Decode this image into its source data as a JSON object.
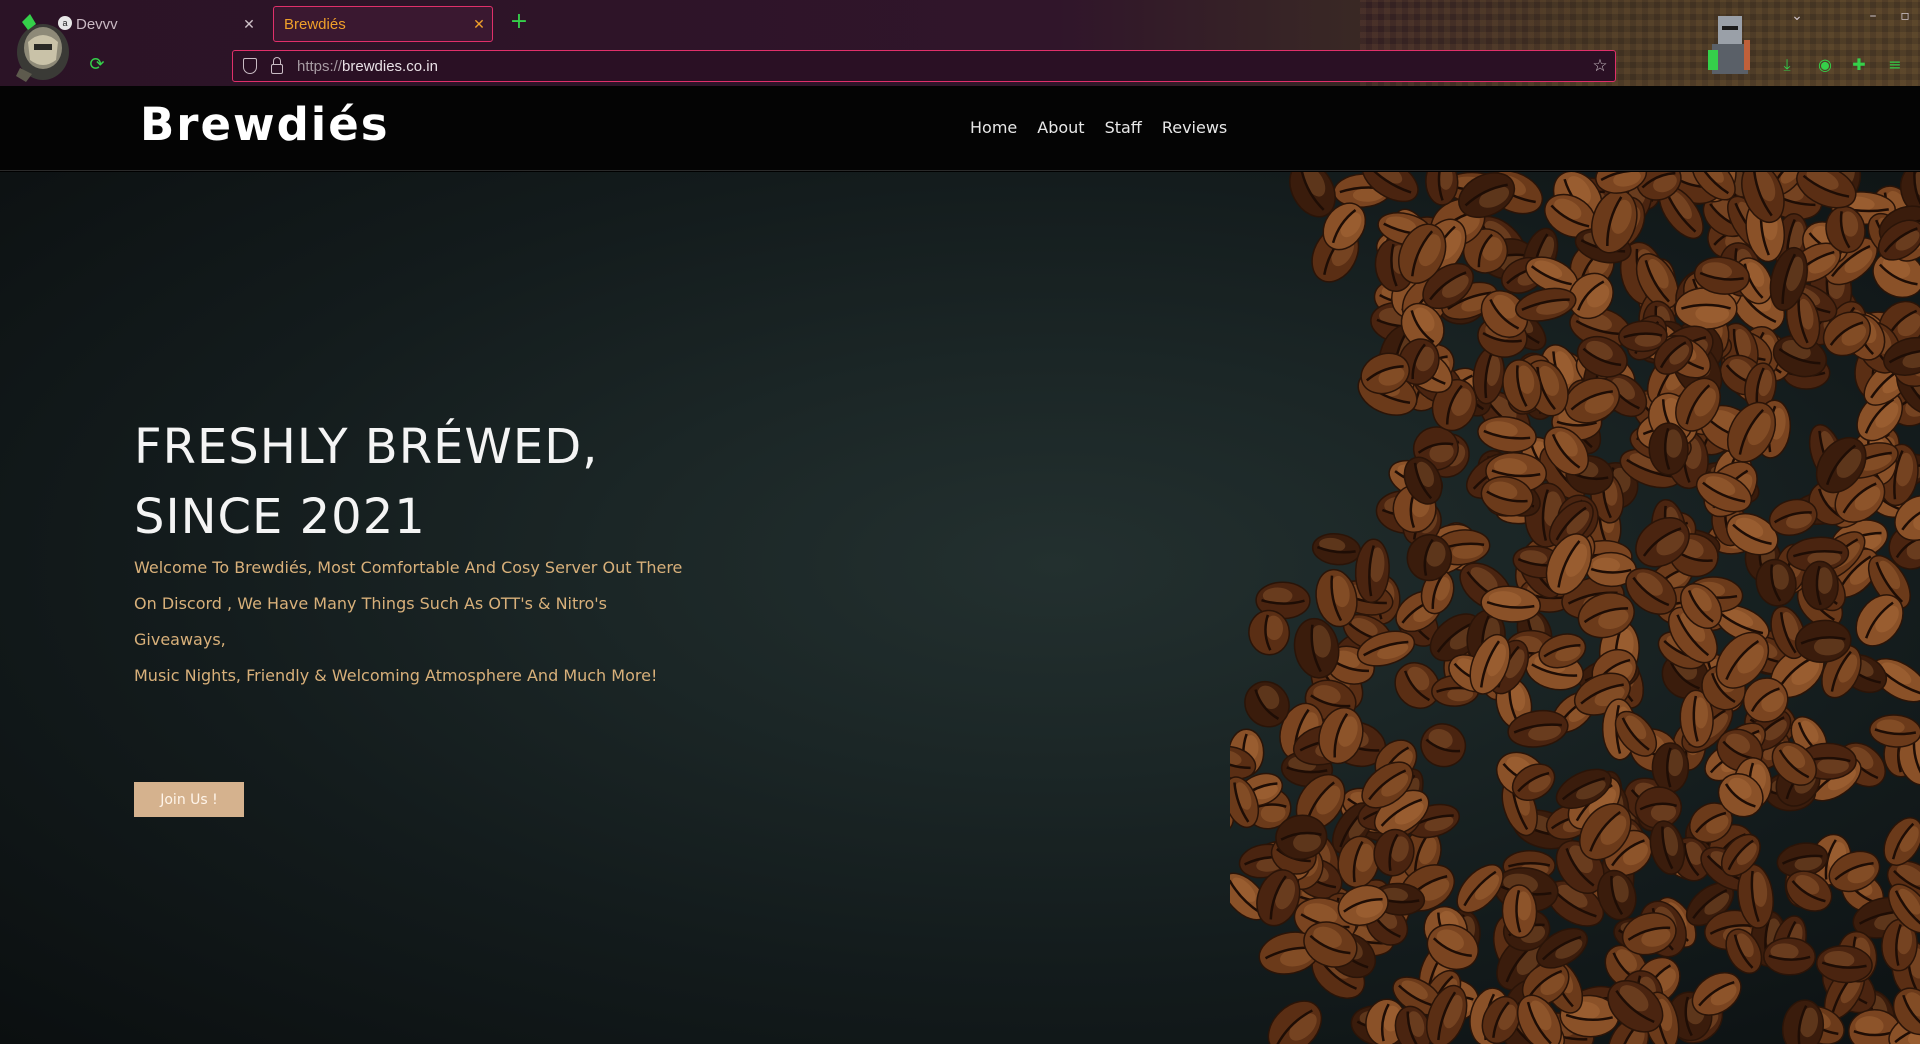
{
  "browser": {
    "tabs": [
      {
        "label": "Devvv",
        "favicon": "a"
      },
      {
        "label": "Brewdiés"
      }
    ],
    "new_tab_icon": "+",
    "url": {
      "scheme": "https://",
      "host": "brewdies.co.in"
    },
    "accent": "#e0306a",
    "icon_color": "#35d04a"
  },
  "site": {
    "logo": "Brewdiés",
    "nav": [
      "Home",
      "About",
      "Staff",
      "Reviews"
    ]
  },
  "hero": {
    "title_line1": "FRESHLY BRÉWED,",
    "title_line2": "SINCE 2021",
    "text_line1": "Welcome To Brewdiés, Most Comfortable And Cosy Server Out There",
    "text_line2": "On Discord , We Have Many Things Such As OTT's & Nitro's Giveaways,",
    "text_line3": "Music Nights, Friendly & Welcoming Atmosphere And Much More!",
    "button": "Join Us !",
    "button_color": "#d5b28e",
    "text_color": "#d8b07a"
  }
}
